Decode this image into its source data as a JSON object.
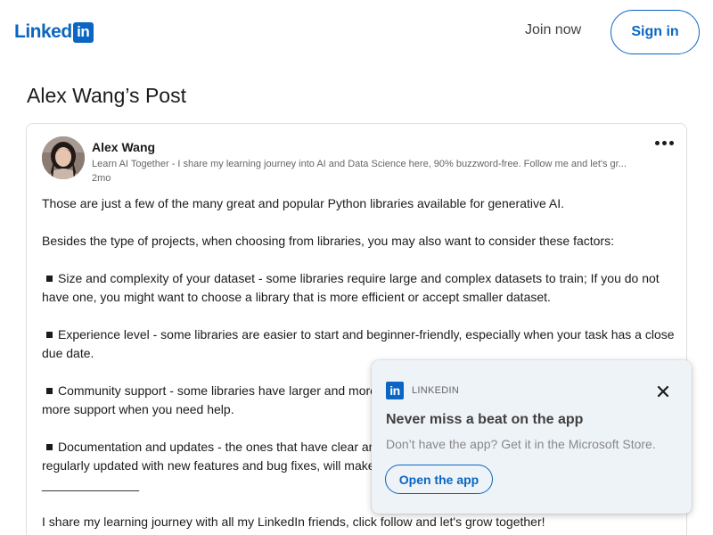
{
  "header": {
    "logo_word": "Linked",
    "logo_badge": "in",
    "join_label": "Join now",
    "signin_label": "Sign in",
    "brand_color": "#0a66c2"
  },
  "page": {
    "title": "Alex Wang’s Post"
  },
  "post": {
    "author_name": "Alex Wang",
    "author_headline": "Learn AI Together - I share my learning journey into AI and Data Science here, 90% buzzword-free. Follow me and let's gr...",
    "time": "2mo",
    "more_icon": "ellipsis-icon",
    "lines": [
      {
        "text": "Those are just a few of the many great and popular Python libraries available for generative AI."
      },
      {
        "text": ""
      },
      {
        "text": "Besides the type of projects, when choosing from libraries, you may also want to consider these factors:"
      },
      {
        "text": ""
      },
      {
        "bullet": true,
        "text": "Size and complexity of your dataset - some libraries require large and complex datasets to train; If you do not"
      },
      {
        "text": "have one, you might want to choose a library that is more efficient or accept smaller dataset."
      },
      {
        "text": ""
      },
      {
        "bullet": true,
        "text": "Experience level -  some libraries are easier to start and beginner-friendly, especially when your task has a close"
      },
      {
        "text": "due date."
      },
      {
        "text": ""
      },
      {
        "bullet": true,
        "text": "Community support - some libraries have larger and more active communities than others, which will give you"
      },
      {
        "text": "more support when you need help."
      },
      {
        "text": ""
      },
      {
        "bullet": true,
        "text": "Documentation and updates - the ones that have clear and comprehensive documentation, and are"
      },
      {
        "text": "regularly updated with new features and bug fixes, will make your life easier."
      },
      {
        "text": "______________"
      },
      {
        "text": ""
      },
      {
        "text": "I share my learning journey with all my LinkedIn friends, click follow and let's grow together!"
      }
    ]
  },
  "toast": {
    "badge": "in",
    "brand": "LINKEDIN",
    "title": "Never miss a beat on the app",
    "description": "Don’t have the app? Get it in the Microsoft Store.",
    "button_label": "Open the app",
    "close_icon": "close-icon"
  }
}
